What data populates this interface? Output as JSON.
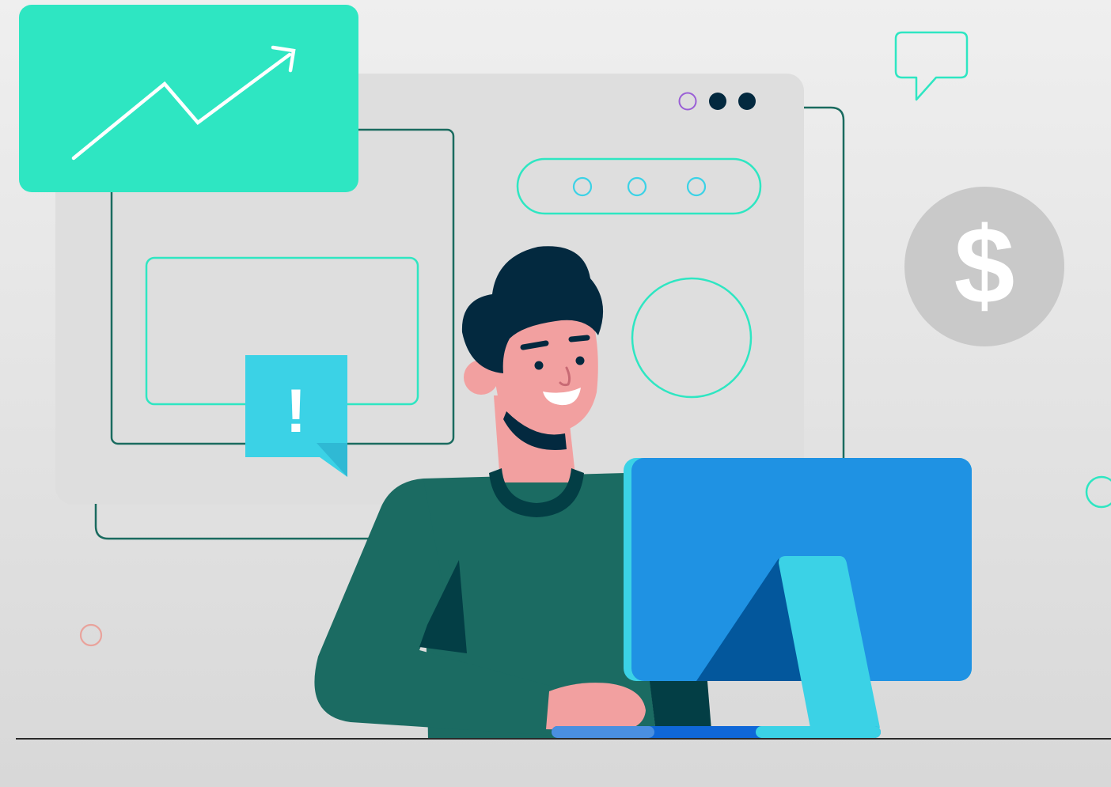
{
  "alert_badge": {
    "symbol": "!",
    "color": "#3bd2e6"
  },
  "coin": {
    "symbol": "$",
    "color": "#c9c9c9"
  },
  "trend_card": {
    "color": "#2ee6c2",
    "icon": "trend-up-arrow-icon"
  },
  "colors": {
    "panel": "#dedede",
    "outline_dark": "#1a6b5f",
    "outline_mint": "#2ee6c2",
    "outline_cyan": "#3bd2e6",
    "hair": "#03293f",
    "skin": "#f2a0a0",
    "sweater": "#1b6b62",
    "sweater_shadow": "#033e45",
    "monitor": "#1f92e3",
    "monitor_stand": "#3bd2e6",
    "monitor_shadow": "#03579c",
    "desk_line": "#2a2a2a"
  },
  "icons": [
    "speech-bubble-icon",
    "dollar-coin-icon",
    "alert-icon",
    "window-dots-icon"
  ]
}
